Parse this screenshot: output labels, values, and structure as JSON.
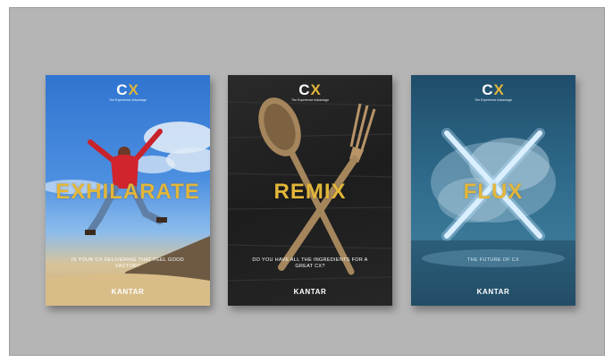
{
  "posters": [
    {
      "logo_mark_c": "C",
      "logo_mark_x": "X",
      "logo_subtitle": "The Experience Advantage",
      "headline": "EXHILARATE",
      "tagline": "IS YOUR CX DELIVERING THAT FEEL GOOD FACTOR?",
      "brand": "KANTAR",
      "scene": "person jumping against blue sky and sand dune"
    },
    {
      "logo_mark_c": "C",
      "logo_mark_x": "X",
      "logo_subtitle": "The Experience Advantage",
      "headline": "REMIX",
      "tagline": "DO YOU HAVE ALL THE INGREDIENTS FOR A GREAT CX?",
      "brand": "KANTAR",
      "scene": "crossed spoon and fork on dark wood"
    },
    {
      "logo_mark_c": "C",
      "logo_mark_x": "X",
      "logo_subtitle": "The Experience Advantage",
      "headline": "FLUX",
      "tagline": "THE FUTURE OF CX",
      "brand": "KANTAR",
      "scene": "glowing neon X in smoke"
    }
  ],
  "colors": {
    "accent_gold": "#e2b63a",
    "background_gray": "#b5b5b5"
  }
}
